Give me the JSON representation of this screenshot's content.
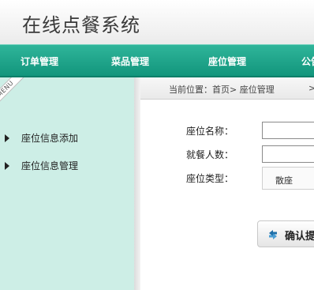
{
  "app": {
    "title": "在线点餐系统"
  },
  "nav": {
    "items": [
      {
        "label": "订单管理"
      },
      {
        "label": "菜品管理"
      },
      {
        "label": "座位管理"
      },
      {
        "label": "公告管理"
      }
    ]
  },
  "sidebar": {
    "ribbon_label": "MENU",
    "items": [
      {
        "label": "座位信息添加"
      },
      {
        "label": "座位信息管理"
      }
    ]
  },
  "breadcrumb": {
    "text": "当前位置：首页> 座位管理",
    "separator": ">"
  },
  "form": {
    "name_label": "座位名称：",
    "name_value": "",
    "capacity_label": "就餐人数：",
    "capacity_value": "",
    "type_label": "座位类型：",
    "type_value": "散座"
  },
  "actions": {
    "confirm_label": "确认提交"
  },
  "colors": {
    "nav_bg": "#1aa58a",
    "sidebar_bg": "#cdeee6",
    "confirm_icon": "#1f6fa8"
  },
  "icons": {
    "confirm": "save-arrows-icon",
    "sidebar_bullet": "triangle-right-icon"
  }
}
